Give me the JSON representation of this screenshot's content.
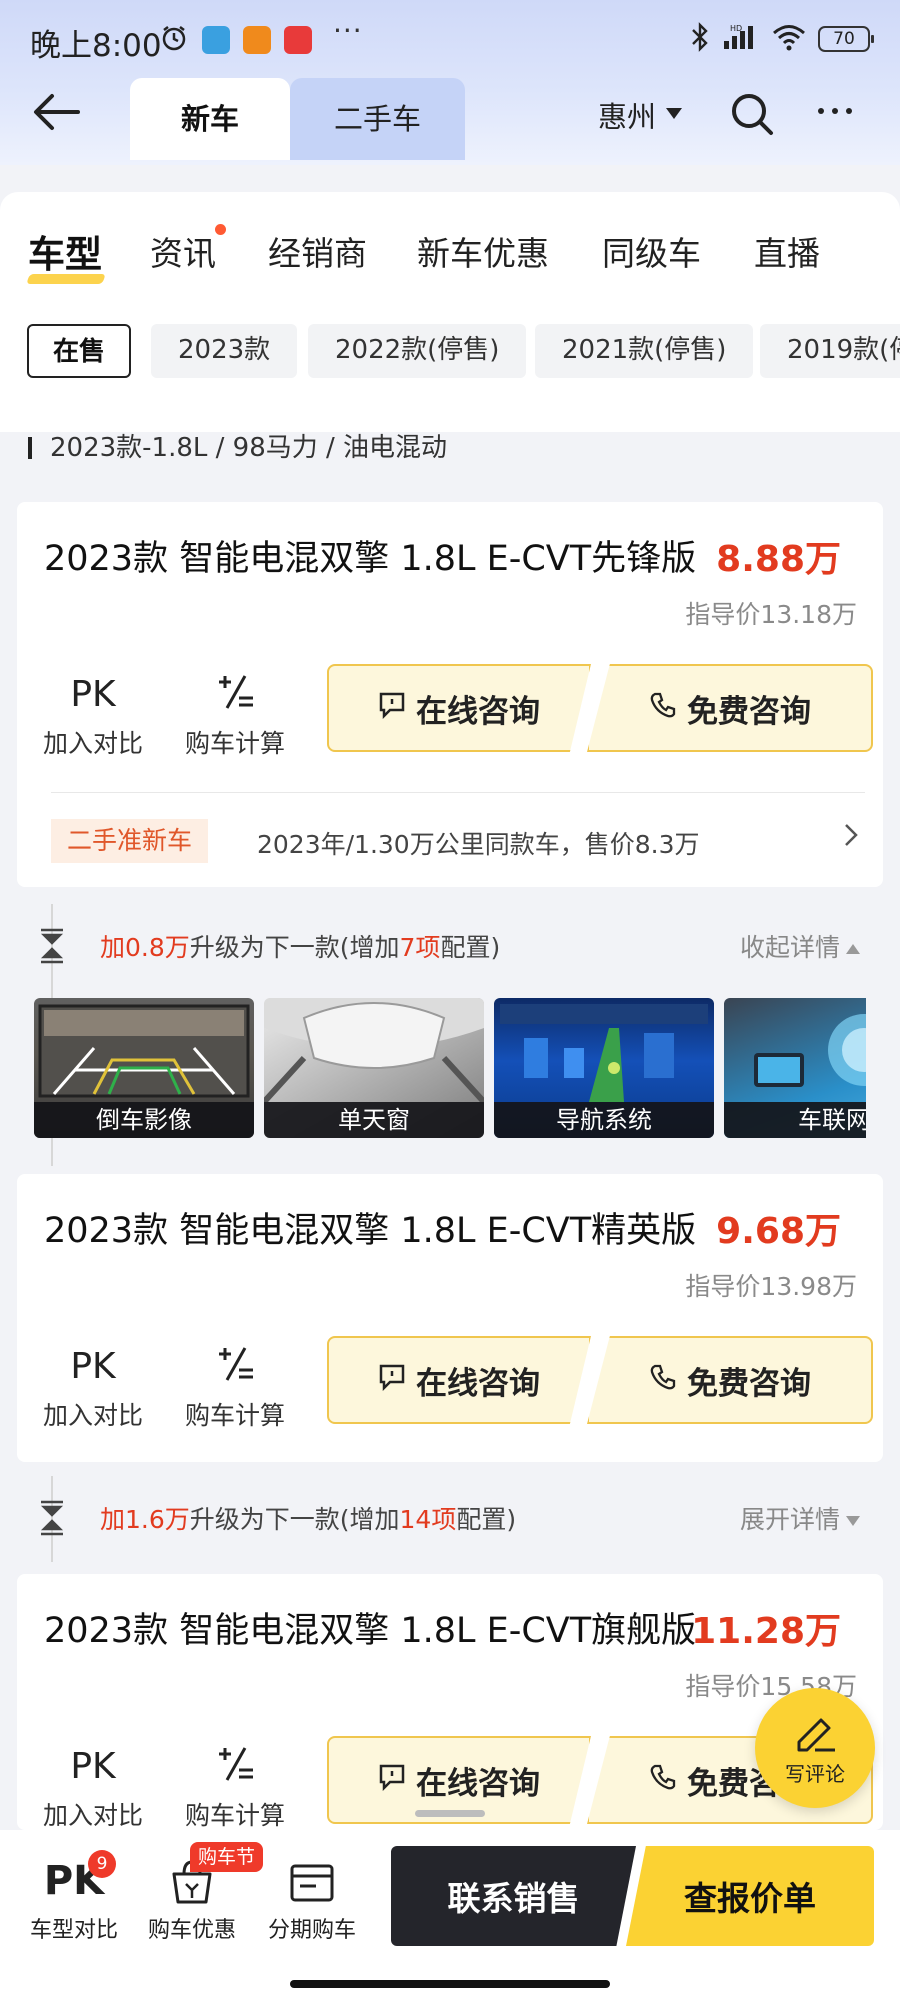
{
  "status_bar": {
    "time": "晚上8:00",
    "battery": "70",
    "icons": [
      "alarm-icon",
      "bluetooth-icon",
      "signal-icon",
      "wifi-icon",
      "battery-icon"
    ]
  },
  "header": {
    "tabs": [
      {
        "label": "新车",
        "active": true
      },
      {
        "label": "二手车",
        "active": false
      }
    ],
    "city": "惠州"
  },
  "sub_tabs": [
    {
      "label": "车型",
      "active": true
    },
    {
      "label": "资讯",
      "dot": true
    },
    {
      "label": "经销商"
    },
    {
      "label": "新车优惠"
    },
    {
      "label": "同级车"
    },
    {
      "label": "直播"
    }
  ],
  "year_filters": [
    {
      "label": "在售",
      "active": true
    },
    {
      "label": "2023款"
    },
    {
      "label": "2022款(停售)"
    },
    {
      "label": "2021款(停售)"
    },
    {
      "label": "2019款(停"
    }
  ],
  "spec_line": "2023款-1.8L / 98马力 / 油电混动",
  "tools": {
    "pk_icon": "PK",
    "pk_label": "加入对比",
    "calc_label": "购车计算"
  },
  "buttons": {
    "consult_online": "在线咨询",
    "consult_free": "免费咨询"
  },
  "cars": [
    {
      "name": "2023款 智能电混双擎 1.8L E-CVT先锋版",
      "price": "8.88万",
      "guide_price": "指导价13.18万",
      "used": {
        "tag": "二手准新车",
        "desc": "2023年/1.30万公里同款车，售价8.3万"
      }
    },
    {
      "name": "2023款 智能电混双擎 1.8L E-CVT精英版",
      "price": "9.68万",
      "guide_price": "指导价13.98万"
    },
    {
      "name": "2023款 智能电混双擎 1.8L E-CVT旗舰版",
      "price": "11.28万",
      "guide_price": "指导价15.58万"
    }
  ],
  "upgrades": [
    {
      "prefix": "加0.8万",
      "mid": "升级为下一款(增加",
      "count": "7项",
      "suffix": "配置)",
      "toggle": "收起详情"
    },
    {
      "prefix": "加1.6万",
      "mid": "升级为下一款(增加",
      "count": "14项",
      "suffix": "配置)",
      "toggle": "展开详情"
    }
  ],
  "features": [
    "倒车影像",
    "单天窗",
    "导航系统",
    "车联网"
  ],
  "comment_label": "写评论",
  "bottom_nav": {
    "compare": {
      "label": "车型对比",
      "badge": "9",
      "icon": "PK"
    },
    "discount": {
      "label": "购车优惠",
      "badge": "购车节"
    },
    "installment": {
      "label": "分期购车"
    },
    "contact": "联系销售",
    "quote": "查报价单"
  },
  "colors": {
    "price_red": "#e23b1f",
    "accent_yellow": "#fbd233",
    "dark_button": "#24252b"
  }
}
